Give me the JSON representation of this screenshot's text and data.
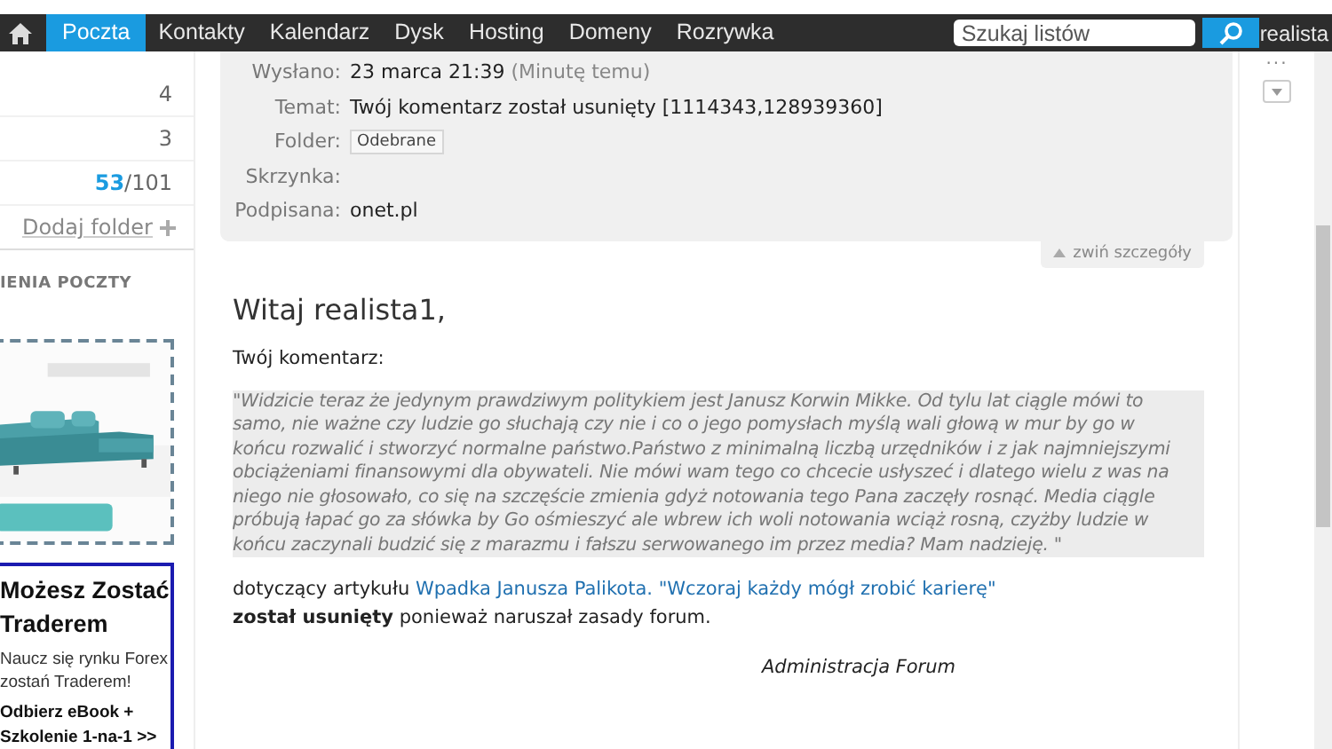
{
  "nav": {
    "items": [
      {
        "label": "Poczta",
        "selected": true
      },
      {
        "label": "Kontakty",
        "selected": false
      },
      {
        "label": "Kalendarz",
        "selected": false
      },
      {
        "label": "Dysk",
        "selected": false
      },
      {
        "label": "Hosting",
        "selected": false
      },
      {
        "label": "Domeny",
        "selected": false
      },
      {
        "label": "Rozrywka",
        "selected": false
      }
    ],
    "search": {
      "placeholder": "Szukaj listów"
    },
    "user": "realista"
  },
  "sidebar": {
    "folders": [
      {
        "count": "4"
      },
      {
        "count": "3"
      },
      {
        "unread": "53",
        "total": "/101"
      }
    ],
    "add_folder": "Dodaj folder",
    "section_heading": "IENIA POCZTY",
    "ads": [
      {
        "kind": "picture"
      },
      {
        "kind": "text",
        "title": "Możesz Zostać Traderem",
        "lines": [
          "Naucz się rynku Forex",
          "zostań Traderem!"
        ],
        "cta": "Odbierz eBook + Szkolenie 1-na-1 >>"
      }
    ]
  },
  "message": {
    "details": [
      {
        "label": "Wysłano:",
        "value": "23 marca 21:39",
        "note": "(Minutę temu)"
      },
      {
        "label": "Temat:",
        "value": "Twój komentarz został usunięty [1114343,128939360]"
      },
      {
        "label": "Folder:",
        "tag": "Odebrane"
      },
      {
        "label": "Skrzynka:"
      },
      {
        "label": "Podpisana:",
        "value": "onet.pl"
      }
    ],
    "collapse": "zwiń szczegóły",
    "greeting": "Witaj realista1,",
    "intro": "Twój komentarz:",
    "quote_lines": [
      "\"Widzicie teraz że jedynym prawdziwym politykiem jest Janusz Korwin Mikke. Od tylu lat ciągle mówi to",
      "samo, nie ważne czy ludzie go słuchają czy nie i co o jego pomysłach myślą wali głową w mur by go w",
      "końcu rozwalić i stworzyć normalne państwo.Państwo z minimalną liczbą urzędników i z jak najmniejszymi",
      "obciążeniami finansowymi dla obywateli. Nie mówi wam tego co chcecie usłyszeć i dlatego wielu z was na",
      "niego nie głosowało, co się na szczęście zmienia gdyż notowania tego Pana zaczęły rosnąć. Media ciągle",
      "próbują łapać go za słówka by Go ośmieszyć ale wbrew ich woli notowania wciąż rosną, czyżby ludzie w",
      "końcu zaczynali budzić się z marazmu i fałszu serwowanego im przez media? Mam nadzieję. \""
    ],
    "article_prefix": "dotyczący artykułu",
    "article_link": "Wpadka Janusza Palikota. \"Wczoraj każdy mógł zrobić karierę\"",
    "removal": "**został usunięty** ponieważ naruszał zasady forum.",
    "signature": "Administracja Forum"
  },
  "rail": {
    "more": "..."
  }
}
